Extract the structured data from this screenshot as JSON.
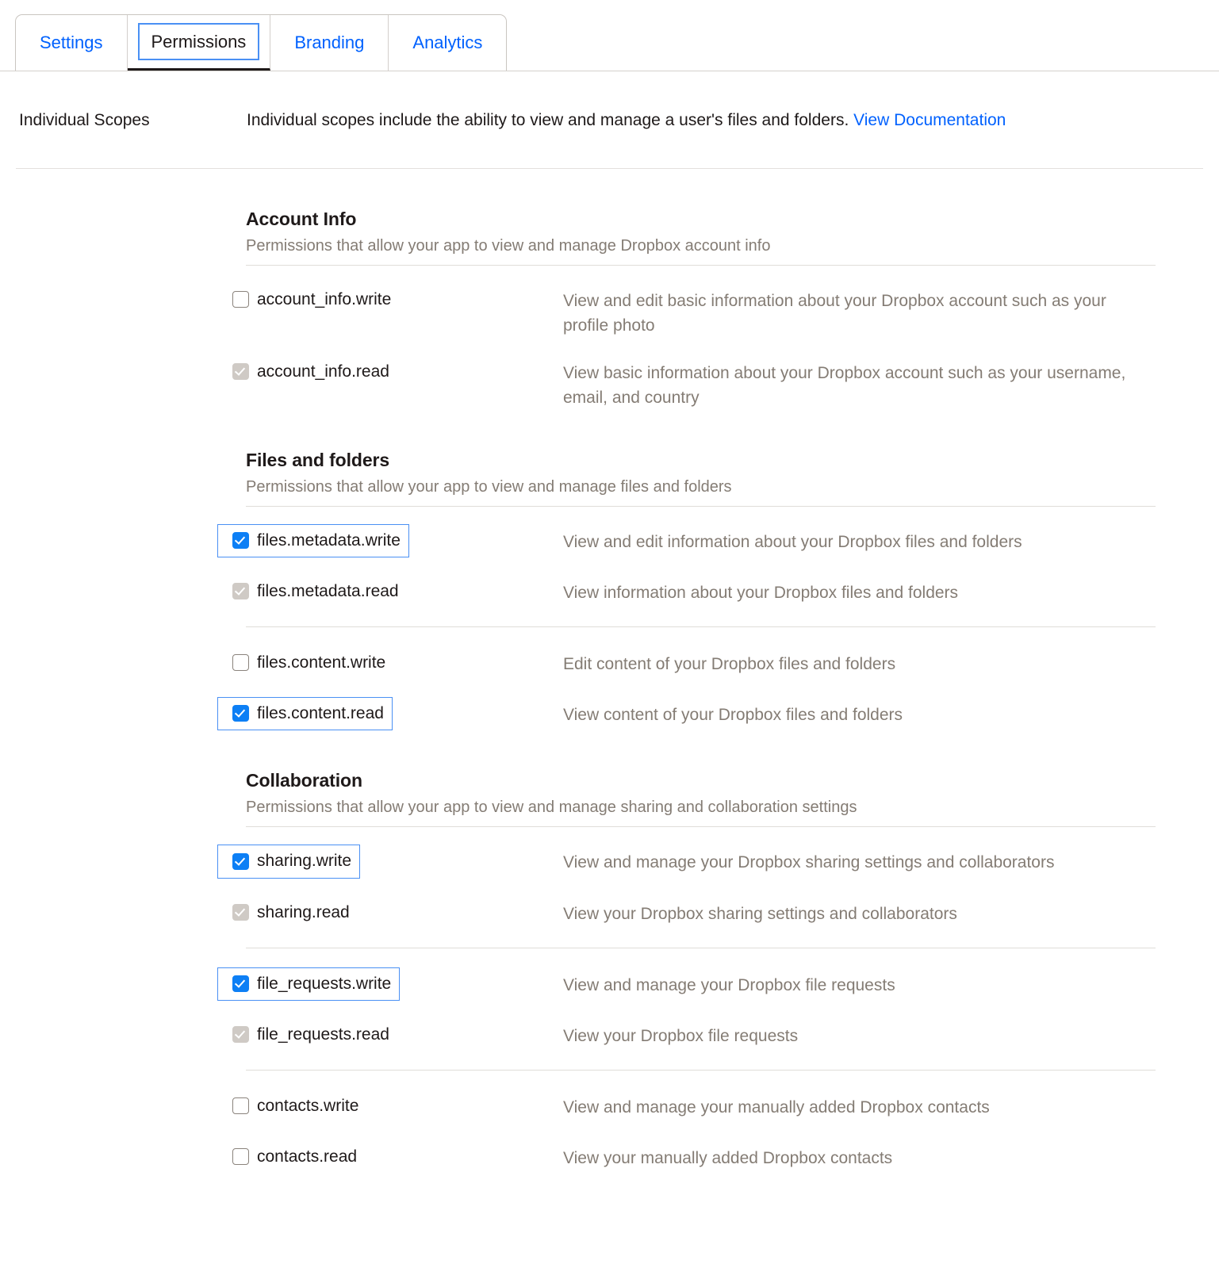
{
  "tabs": [
    {
      "label": "Settings",
      "active": false
    },
    {
      "label": "Permissions",
      "active": true
    },
    {
      "label": "Branding",
      "active": false
    },
    {
      "label": "Analytics",
      "active": false
    }
  ],
  "individual_scopes": {
    "label": "Individual Scopes",
    "description": "Individual scopes include the ability to view and manage a user's files and folders.",
    "link_text": "View Documentation"
  },
  "colors": {
    "accent_blue": "#0061fe",
    "checkbox_blue": "#0d7ff5",
    "focus_ring": "#4a90f4",
    "muted_text": "#847c74",
    "text": "#1e1919",
    "rule": "#e0ddd9",
    "disabled_checkbox": "#cfcac5"
  },
  "sections": [
    {
      "title": "Account Info",
      "subtitle": "Permissions that allow your app to view and manage Dropbox account info",
      "groups": [
        {
          "rows": [
            {
              "name": "account_info.write",
              "description": "View and edit basic information about your Dropbox account such as your profile photo",
              "state": "unchecked",
              "focused": false
            },
            {
              "name": "account_info.read",
              "description": "View basic information about your Dropbox account such as your username, email, and country",
              "state": "disabled-checked",
              "focused": false
            }
          ]
        }
      ]
    },
    {
      "title": "Files and folders",
      "subtitle": "Permissions that allow your app to view and manage files and folders",
      "groups": [
        {
          "rows": [
            {
              "name": "files.metadata.write",
              "description": "View and edit information about your Dropbox files and folders",
              "state": "checked",
              "focused": true
            },
            {
              "name": "files.metadata.read",
              "description": "View information about your Dropbox files and folders",
              "state": "disabled-checked",
              "focused": false
            }
          ]
        },
        {
          "rows": [
            {
              "name": "files.content.write",
              "description": "Edit content of your Dropbox files and folders",
              "state": "unchecked",
              "focused": false
            },
            {
              "name": "files.content.read",
              "description": "View content of your Dropbox files and folders",
              "state": "checked",
              "focused": true
            }
          ]
        }
      ]
    },
    {
      "title": "Collaboration",
      "subtitle": "Permissions that allow your app to view and manage sharing and collaboration settings",
      "groups": [
        {
          "rows": [
            {
              "name": "sharing.write",
              "description": "View and manage your Dropbox sharing settings and collaborators",
              "state": "checked",
              "focused": true
            },
            {
              "name": "sharing.read",
              "description": "View your Dropbox sharing settings and collaborators",
              "state": "disabled-checked",
              "focused": false
            }
          ]
        },
        {
          "rows": [
            {
              "name": "file_requests.write",
              "description": "View and manage your Dropbox file requests",
              "state": "checked",
              "focused": true
            },
            {
              "name": "file_requests.read",
              "description": "View your Dropbox file requests",
              "state": "disabled-checked",
              "focused": false
            }
          ]
        },
        {
          "rows": [
            {
              "name": "contacts.write",
              "description": "View and manage your manually added Dropbox contacts",
              "state": "unchecked",
              "focused": false
            },
            {
              "name": "contacts.read",
              "description": "View your manually added Dropbox contacts",
              "state": "unchecked",
              "focused": false
            }
          ]
        }
      ]
    }
  ]
}
